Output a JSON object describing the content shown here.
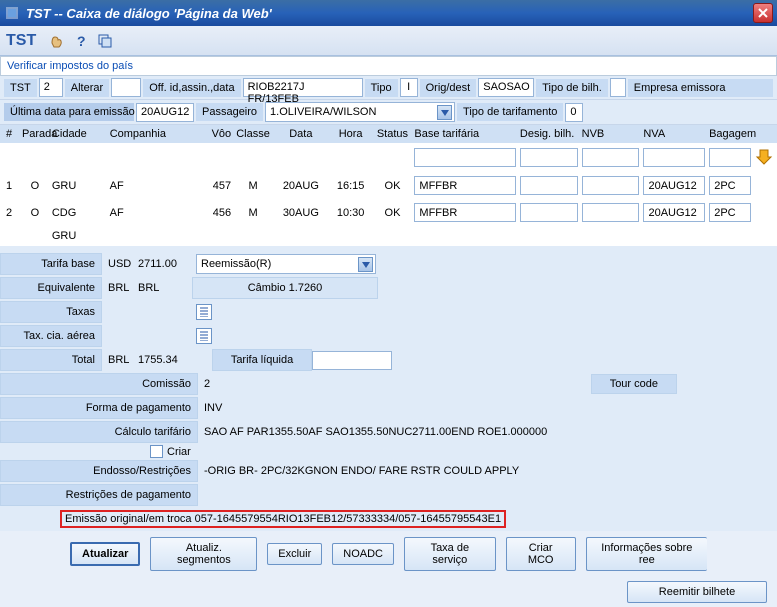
{
  "window": {
    "title": "TST -- Caixa de diálogo 'Página da Web'"
  },
  "toolbar": {
    "app_label": "TST",
    "verify_link": "Verificar impostos do país"
  },
  "filters": {
    "tst_label": "TST",
    "tst_value": "2",
    "alterar": "Alterar",
    "off_label": "Off. id,assin.,data",
    "off_value": "RIOB2217J FR/13FEB",
    "tipo_label": "Tipo",
    "tipo_value": "I",
    "origdest_label": "Orig/dest",
    "origdest_value": "SAOSAO",
    "tipobilh_label": "Tipo de bilh.",
    "tipobilh_value": "",
    "empresa_label": "Empresa emissora",
    "ultima_label": "Última data para emissão",
    "ultima_value": "20AUG12",
    "pass_label": "Passageiro",
    "pass_value": "1.OLIVEIRA/WILSON",
    "tipotarif_label": "Tipo de tarifamento",
    "tipotarif_value": "0"
  },
  "grid": {
    "headers": {
      "num": "#",
      "parada": "Parada",
      "cidade": "Cidade",
      "companhia": "Companhia",
      "voo": "Vôo",
      "classe": "Classe",
      "data": "Data",
      "hora": "Hora",
      "status": "Status",
      "base": "Base tarifária",
      "desig": "Desig. bilh.",
      "nvb": "NVB",
      "nva": "NVA",
      "bagagem": "Bagagem"
    },
    "rows": [
      {
        "num": "1",
        "parada": "O",
        "cidade": "GRU",
        "companhia": "AF",
        "voo": "457",
        "classe": "M",
        "data": "20AUG",
        "hora": "16:15",
        "status": "OK",
        "base": "MFFBR",
        "desig": "",
        "nvb": "",
        "nva": "20AUG12",
        "bag": "2PC"
      },
      {
        "num": "2",
        "parada": "O",
        "cidade": "CDG",
        "companhia": "AF",
        "voo": "456",
        "classe": "M",
        "data": "30AUG",
        "hora": "10:30",
        "status": "OK",
        "base": "MFFBR",
        "desig": "",
        "nvb": "",
        "nva": "20AUG12",
        "bag": "2PC"
      },
      {
        "num": "",
        "parada": "",
        "cidade": "GRU",
        "companhia": "",
        "voo": "",
        "classe": "",
        "data": "",
        "hora": "",
        "status": "",
        "base": "",
        "desig": "",
        "nvb": "",
        "nva": "",
        "bag": ""
      }
    ]
  },
  "form": {
    "tarifa_base_label": "Tarifa base",
    "tarifa_base_cur": "USD",
    "tarifa_base_val": "2711.00",
    "reemissao": "Reemissão(R)",
    "equivalente_label": "Equivalente",
    "equivalente_cur": "BRL",
    "equivalente_val": "BRL",
    "cambio_label": "Câmbio 1.7260",
    "taxas_label": "Taxas",
    "tax_cia_label": "Tax. cia. aérea",
    "total_label": "Total",
    "total_cur": "BRL",
    "total_val": "1755.34",
    "tarifa_liquida": "Tarifa líquida",
    "comissao_label": "Comissão",
    "comissao_val": "2",
    "tourcode_label": "Tour code",
    "forma_pag_label": "Forma de pagamento",
    "forma_pag_val": "INV",
    "calculo_label": "Cálculo tarifário",
    "calculo_val": "SAO AF PAR1355.50AF SAO1355.50NUC2711.00END ROE1.000000",
    "criar_label": "Criar",
    "endosso_label": "Endosso/Restrições",
    "endosso_val": "-ORIG BR- 2PC/32KGNON ENDO/ FARE RSTR COULD APPLY",
    "restricoes_label": "Restrições de pagamento",
    "emissao_label": "Emissão original/em troca",
    "emissao_val": "057-1645579554RIO13FEB12/57333334/057-16455795543E1"
  },
  "buttons": {
    "atualizar": "Atualizar",
    "atualiz_seg": "Atualiz. segmentos",
    "excluir": "Excluir",
    "noadc": "NOADC",
    "taxa_serv": "Taxa de serviço",
    "criar_mco": "Criar MCO",
    "info_reem": "Informações sobre ree",
    "reemitir": "Reemitir bilhete"
  }
}
